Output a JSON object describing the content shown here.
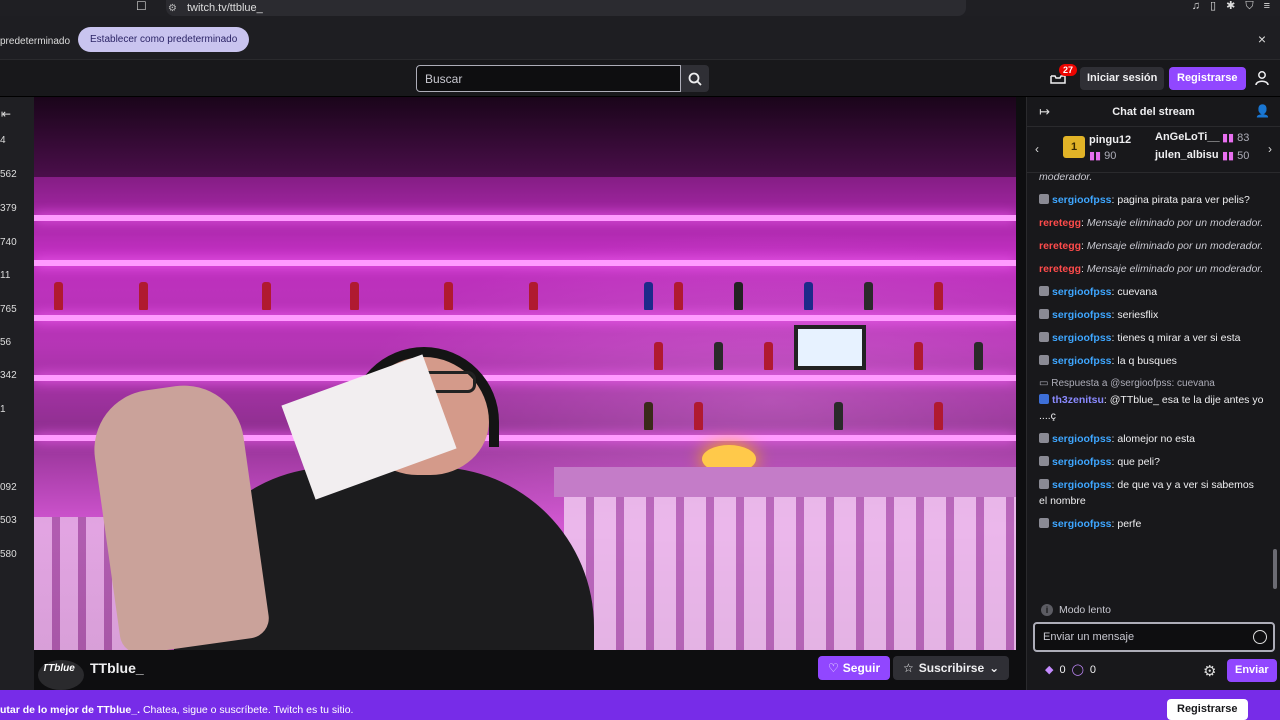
{
  "browser": {
    "url": "twitch.tv/ttblue_",
    "default_message": "predeterminado",
    "set_default_label": "Establecer como predeterminado",
    "close_glyph": "×"
  },
  "nav": {
    "search_placeholder": "Buscar",
    "notification_count": "27",
    "login_label": "Iniciar sesión",
    "signup_label": "Registrarse"
  },
  "sidebar": {
    "counts": [
      "4",
      "562",
      "379",
      "740",
      "11",
      "765",
      "56",
      "342",
      "1",
      "092",
      "503",
      "580"
    ]
  },
  "channel": {
    "name": "TTblue_",
    "avatar_text": "TTblue",
    "follow_label": "Seguir",
    "subscribe_label": "Suscribirse"
  },
  "chat": {
    "title": "Chat del stream",
    "gifters": [
      {
        "name": "pingu12",
        "count": "90"
      },
      {
        "name": "AnGeLoTi__",
        "count": "83"
      },
      {
        "name": "julen_albisu",
        "count": "50"
      }
    ],
    "messages": [
      {
        "type": "partial",
        "text": "moderador."
      },
      {
        "type": "user",
        "user": "sergioofpss",
        "text": "pagina pirata para ver pelis?"
      },
      {
        "type": "deleted",
        "user": "reretegg",
        "text": "Mensaje eliminado por un moderador."
      },
      {
        "type": "deleted",
        "user": "reretegg",
        "text": "Mensaje eliminado por un moderador."
      },
      {
        "type": "deleted",
        "user": "reretegg",
        "text": "Mensaje eliminado por un moderador."
      },
      {
        "type": "user",
        "user": "sergioofpss",
        "text": "cuevana"
      },
      {
        "type": "user",
        "user": "sergioofpss",
        "text": "seriesflix"
      },
      {
        "type": "user",
        "user": "sergioofpss",
        "text": "tienes q mirar a ver si esta"
      },
      {
        "type": "user",
        "user": "sergioofpss",
        "text": "la q busques"
      },
      {
        "type": "reply",
        "reply_text": "Respuesta a @sergioofpss: cuevana",
        "user": "th3zenitsu",
        "text": "@TTblue_ esa te la dije antes yo ....ç"
      },
      {
        "type": "user",
        "user": "sergioofpss",
        "text": "alomejor no esta"
      },
      {
        "type": "user",
        "user": "sergioofpss",
        "text": "que peli?"
      },
      {
        "type": "user",
        "user": "sergioofpss",
        "text": "de que va y a ver si sabemos el nombre"
      },
      {
        "type": "user",
        "user": "sergioofpss",
        "text": "perfe"
      }
    ],
    "slow_mode_label": "Modo lento",
    "input_placeholder": "Enviar un mensaje",
    "bits_count": "0",
    "points_count": "0",
    "send_label": "Enviar"
  },
  "banner": {
    "text_prefix": "utar de lo mejor de TTblue_.",
    "text_suffix": " Chatea, sigue o suscríbete. Twitch es tu sitio.",
    "signup_label": "Registrarse"
  },
  "colors": {
    "accent": "#9147ff",
    "banner": "#772ce8",
    "username_blue": "#3ea6ff",
    "username_red": "#ff4b4b"
  }
}
